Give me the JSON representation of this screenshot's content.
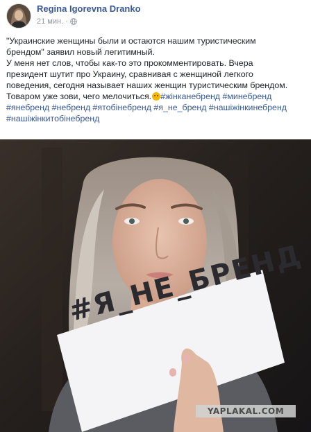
{
  "post": {
    "author": "Regina Igorevna Dranko",
    "time": "21 мин.",
    "separator": "·",
    "privacy_icon": "globe-icon",
    "text_lines": [
      "\"Украинские женщины были и остаются нашим туристическим",
      "брендом\" заявил новый легитимный.",
      "У меня нет слов, чтобы как-то это прокомментировать. Вчера",
      "президент шутит про Украину, сравнивая с женщиной легкого",
      "поведения, сегодня называет наших женщин туристическим брендом.",
      "Товаром уже зови, чего мелочиться."
    ],
    "emoji": "pouting-face-emoji",
    "hashtags": [
      "#жінканебренд",
      "#минебренд",
      "#янебренд",
      "#небренд",
      "#ятобінебренд",
      "#я_не_бренд",
      "#нашіжінкинебренд",
      "#нашіжінкитобінебренд"
    ]
  },
  "photo": {
    "sign_text": "#Я_НЕ_БРЕНД",
    "watermark": "YAPLAKAL.COM"
  },
  "colors": {
    "link": "#385898",
    "hashtag": "#365899",
    "meta": "#90949c",
    "text": "#1d2129"
  }
}
